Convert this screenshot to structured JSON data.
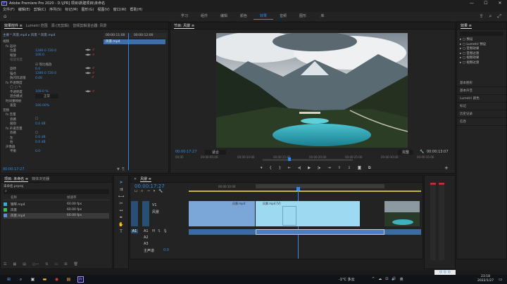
{
  "window": {
    "title": "Adobe Premiere Pro 2020 - D:\\[PR] 项目\\新建项目\\未命名",
    "controls": [
      "—",
      "☐",
      "✕"
    ]
  },
  "menu": [
    "文件(F)",
    "编辑(E)",
    "剪辑(C)",
    "序列(S)",
    "标记(M)",
    "图形(G)",
    "视图(V)",
    "窗口(W)",
    "帮助(H)"
  ],
  "workspaces": {
    "tabs": [
      "学习",
      "组件",
      "编辑",
      "颜色",
      "效果",
      "音频",
      "图形",
      "库"
    ],
    "active": "效果"
  },
  "effect_controls": {
    "tabs": [
      "效果控件 ≡",
      "Lumetri 范围",
      "源:(无剪辑)",
      "音频剪辑混合器: 风景"
    ],
    "source": "主要 * 风景.mp4",
    "clip": "风景 * 风景.mp4",
    "timecodes": [
      "00:00:11:00",
      "00:00:12:00"
    ],
    "clip_label": "风景.mp4",
    "sections": {
      "video": "视频",
      "motion": "fx 运动",
      "opacity": "fx 不透明度",
      "time_remap": "时间重映射",
      "audio": "音频",
      "volume": "fx 音量",
      "channel_volume": "fx 声道音量",
      "panner": "声像器"
    },
    "props": [
      {
        "name": "位置",
        "value": "1280.0   720.0"
      },
      {
        "name": "缩放",
        "value": "100.0"
      },
      {
        "name": "缩放宽度",
        "value": ""
      },
      {
        "name": "",
        "value": "☑ 等比缩放"
      },
      {
        "name": "旋转",
        "value": "0.0"
      },
      {
        "name": "锚点",
        "value": "1280.0   720.0"
      },
      {
        "name": "防闪烁滤镜",
        "value": "0.00"
      },
      {
        "name": "不透明度",
        "value": "100.0 %"
      },
      {
        "name": "混合模式",
        "value": "正常"
      },
      {
        "name": "速度",
        "value": "100.00%"
      },
      {
        "name": "旁路",
        "value": "☐"
      },
      {
        "name": "级别",
        "value": "0.0 dB"
      },
      {
        "name": "旁路",
        "value": "☐"
      },
      {
        "name": "左",
        "value": "0.0 dB"
      },
      {
        "name": "右",
        "value": "0.0 dB"
      },
      {
        "name": "平衡",
        "value": "0.0"
      }
    ],
    "timecode": "00:00:17:27"
  },
  "program": {
    "title": "节目: 风景 ≡",
    "timecode": "00:00:17:27",
    "fit": "适合",
    "quality": "完整",
    "duration": "00:00:13:07",
    "ruler": [
      "00:00",
      "00:00:05:00",
      "00:00:10:00",
      "00:00:15:00",
      "00:00:20:00",
      "00:00:25:00",
      "00:00:30:00",
      "00:00:35:00"
    ]
  },
  "project": {
    "tabs": [
      "项目: 未命名 ≡",
      "媒体浏览器"
    ],
    "file": "未命名.prproj",
    "search_placeholder": "",
    "columns": [
      "名称",
      "帧速率"
    ],
    "items": [
      {
        "name": "钢琴.mp4",
        "rate": "60.00 fps",
        "color": "#3ea9cf"
      },
      {
        "name": "风景",
        "rate": "60.00 fps",
        "color": "#46b754"
      },
      {
        "name": "风景.mp4",
        "rate": "60.00 fps",
        "color": "#5c8fd6"
      }
    ]
  },
  "timeline": {
    "title": "风景 ≡",
    "timecode": "00:00:17:27",
    "ruler": [
      "00:00:10:00",
      "00:00:15:00",
      "00:00:20:00",
      "00:00:25:00"
    ],
    "tracks": [
      "V2",
      "V1",
      "A1",
      "A2",
      "A3",
      "主声道"
    ],
    "master_value": "0.0",
    "clip_v1a": "风景.mp4",
    "clip_v1b": "风景.mp4 [V]",
    "clip_label": "风景"
  },
  "right_panel": {
    "title": "效果 ≡",
    "folders": [
      "预设",
      "Lumetri 预设",
      "音频效果",
      "音频过渡",
      "视频效果",
      "视频过渡"
    ],
    "sections": [
      "基本图形",
      "基本声音",
      "Lumetri 颜色",
      "标记",
      "历史记录",
      "信息"
    ]
  },
  "taskbar": {
    "weather": "-1°C 多云",
    "time": "23:18",
    "date": "2022/1/27",
    "lang": "英"
  },
  "colors": {
    "accent": "#2d8ceb",
    "clip_blue": "#7ba7d8",
    "clip_cyan": "#9ed9f2",
    "audio_clip": "#3c6ba0",
    "playhead": "#2d8ceb"
  }
}
